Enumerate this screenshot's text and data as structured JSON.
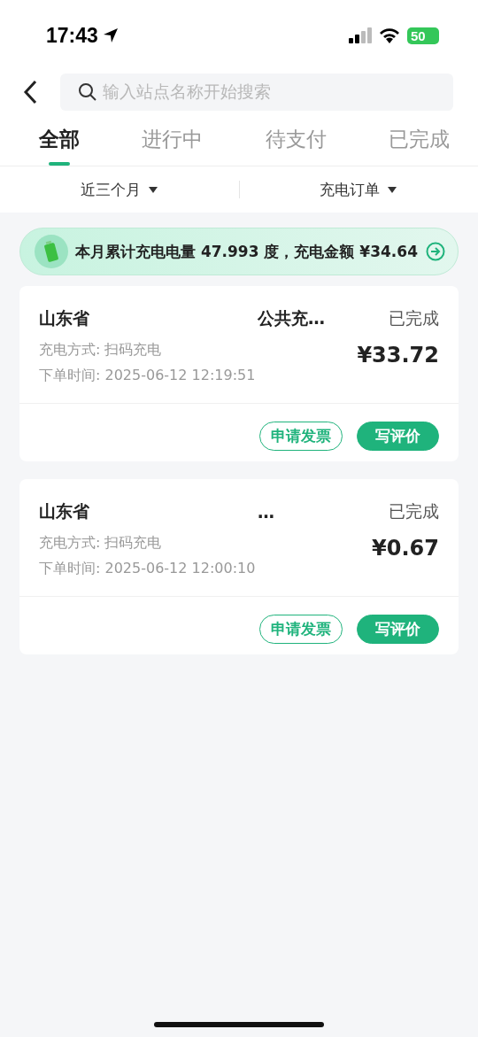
{
  "status_bar": {
    "time": "17:43",
    "battery": "50"
  },
  "search": {
    "placeholder": "输入站点名称开始搜索"
  },
  "tabs": [
    {
      "label": "全部",
      "selected": true
    },
    {
      "label": "进行中",
      "selected": false
    },
    {
      "label": "待支付",
      "selected": false
    },
    {
      "label": "已完成",
      "selected": false
    }
  ],
  "filters": [
    "近三个月",
    "充电订单"
  ],
  "summary": {
    "text": "本月累计充电电量 47.993 度，充电金额 ¥34.64"
  },
  "orders": [
    {
      "station_start": "山东省",
      "station_tail": "公共充…",
      "status": "已完成",
      "method": "充电方式: 扫码充电",
      "time": "下单时间: 2025-06-12 12:19:51",
      "amount": "¥33.72",
      "buttons": [
        "申请发票",
        "写评价"
      ]
    },
    {
      "station_start": "山东省",
      "station_tail": "…",
      "status": "已完成",
      "method": "充电方式: 扫码充电",
      "time": "下单时间: 2025-06-12 12:00:10",
      "amount": "¥0.67",
      "buttons": [
        "申请发票",
        "写评价"
      ]
    }
  ]
}
